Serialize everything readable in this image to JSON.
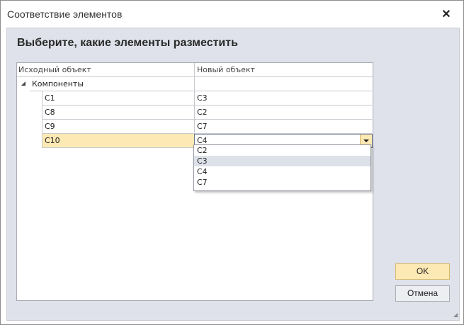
{
  "window": {
    "title": "Соответствие элементов",
    "close_glyph": "✕"
  },
  "heading": "Выберите, какие элементы разместить",
  "grid": {
    "columns": [
      "Исходный объект",
      "Новый объект"
    ],
    "group": {
      "label": "Компоненты",
      "value": ""
    },
    "rows": [
      {
        "source": "C1",
        "target": "C3"
      },
      {
        "source": "C8",
        "target": "C2"
      },
      {
        "source": "C9",
        "target": "C7"
      },
      {
        "source": "C10",
        "target": "C4"
      }
    ],
    "selected_index": 3
  },
  "dropdown": {
    "options": [
      "C2",
      "C3",
      "C4",
      "C7"
    ],
    "highlighted": "C3"
  },
  "buttons": {
    "ok": "OK",
    "cancel": "Отмена"
  },
  "colors": {
    "selection": "#fde9b4",
    "client_background": "#dfe2ea",
    "hover": "#dde1e9"
  },
  "icons": {
    "close": "close-icon",
    "expander": "tree-collapse-icon",
    "dropdown": "chevron-down-icon",
    "grip": "resize-grip-icon"
  }
}
